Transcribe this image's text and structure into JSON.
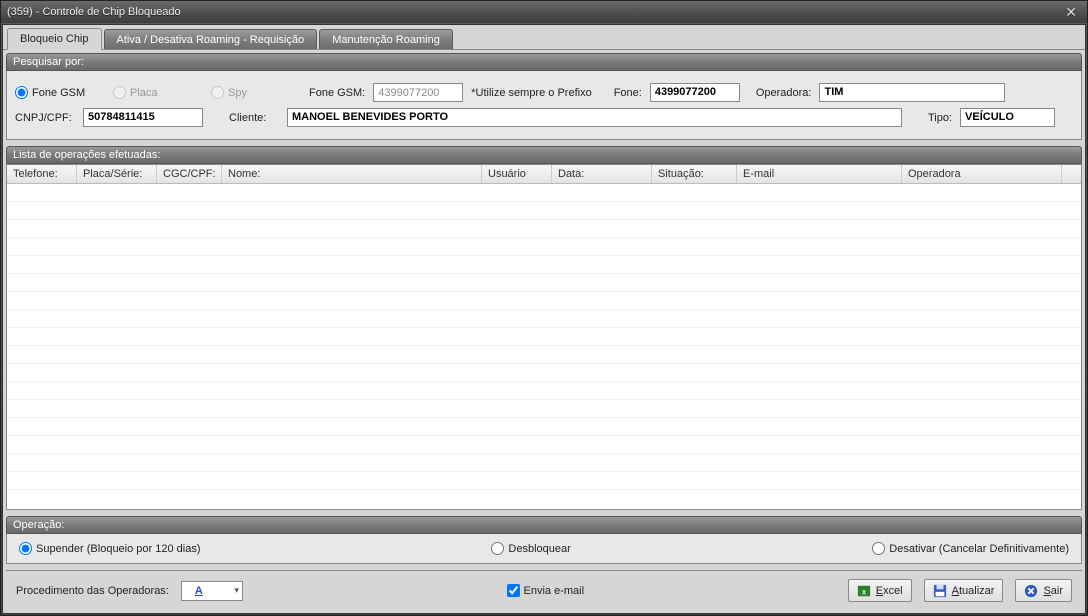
{
  "title": "(359) - Controle de Chip Bloqueado",
  "tabs": [
    {
      "label": "Bloqueio Chip"
    },
    {
      "label": "Ativa / Desativa Roaming - Requisição"
    },
    {
      "label": "Manutenção Roaming"
    }
  ],
  "search": {
    "header": "Pesquisar por:",
    "radios": [
      {
        "label": "Fone GSM",
        "checked": true,
        "enabled": true
      },
      {
        "label": "Placa",
        "checked": false,
        "enabled": false
      },
      {
        "label": "Spy",
        "checked": false,
        "enabled": false
      }
    ],
    "fone_gsm_label": "Fone GSM:",
    "fone_gsm_value": "4399077200",
    "fone_gsm_hint": "*Utilize sempre o Prefixo",
    "fone_label": "Fone:",
    "fone_value": "4399077200",
    "operadora_label": "Operadora:",
    "operadora_value": "TIM",
    "cnpj_label": "CNPJ/CPF:",
    "cnpj_value": "50784811415",
    "cliente_label": "Cliente:",
    "cliente_value": "MANOEL BENEVIDES PORTO",
    "tipo_label": "Tipo:",
    "tipo_value": "VEÍCULO"
  },
  "list": {
    "header": "Lista de operações efetuadas:",
    "columns": [
      "Telefone:",
      "Placa/Série:",
      "CGC/CPF:",
      "Nome:",
      "Usuário",
      "Data:",
      "Situação:",
      "E-mail",
      "Operadora"
    ],
    "widths": [
      70,
      80,
      65,
      260,
      70,
      100,
      85,
      165,
      160
    ],
    "rows": []
  },
  "operation": {
    "header": "Operação:",
    "options": [
      {
        "label": "Supender (Bloqueio por 120 dias)",
        "checked": true
      },
      {
        "label": "Desbloquear",
        "checked": false
      },
      {
        "label": "Desativar (Cancelar Definitivamente)",
        "checked": false
      }
    ]
  },
  "footer": {
    "proc_label": "Procedimento das Operadoras:",
    "proc_value": "A",
    "envia_email": "Envia e-mail",
    "envia_email_checked": true,
    "buttons": {
      "excel": "Excel",
      "atualizar": "Atualizar",
      "sair": "Sair"
    }
  }
}
